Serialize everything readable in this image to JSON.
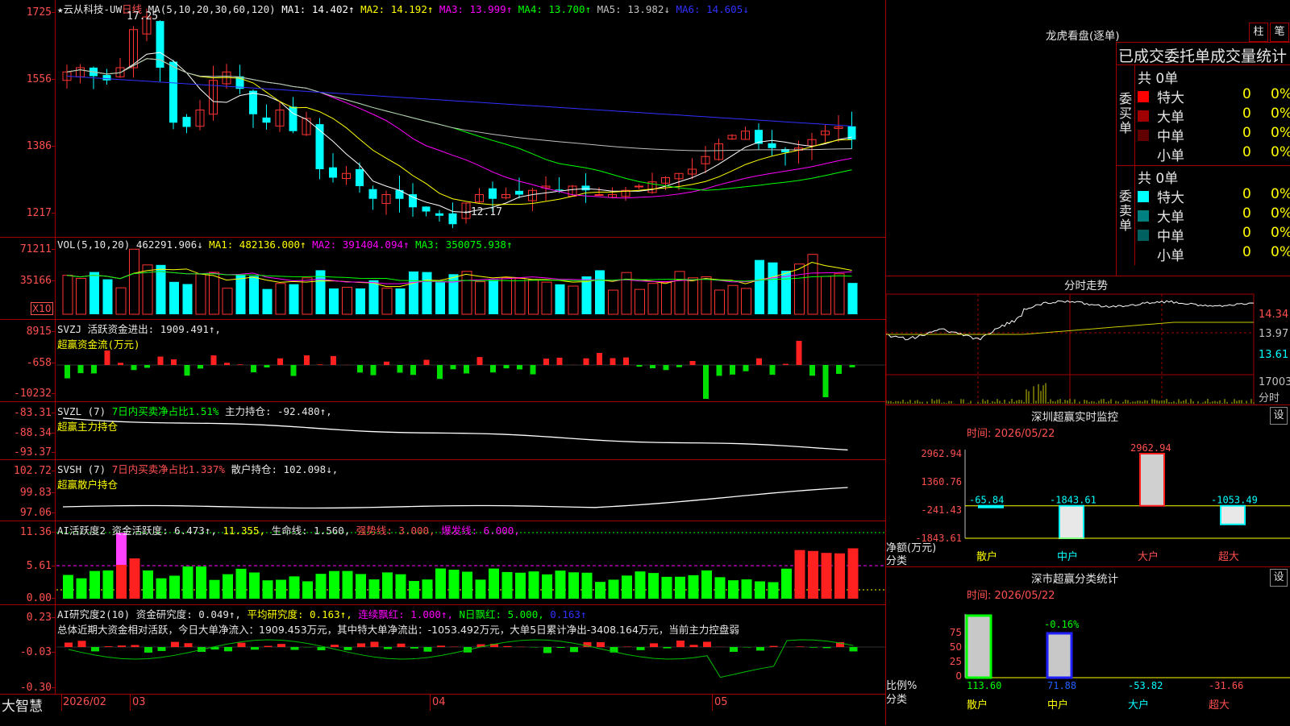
{
  "main": {
    "title": "★云从科技-UW",
    "period": "日线",
    "ma_label": "MA(5,10,20,30,60,120)",
    "ma_values": [
      {
        "text": "MA1: 14.402↑",
        "color": "#ffffff"
      },
      {
        "text": "MA2: 14.192↑",
        "color": "#ffff00"
      },
      {
        "text": "MA3: 13.999↑",
        "color": "#ff00ff"
      },
      {
        "text": "MA4: 13.700↑",
        "color": "#00ff00"
      },
      {
        "text": "MA5: 13.982↓",
        "color": "#c0c0c0"
      },
      {
        "text": "MA6: 14.605↓",
        "color": "#3030ff"
      }
    ],
    "y_ticks": [
      "1725",
      "1556",
      "1386",
      "1217"
    ],
    "high_label": "17.25",
    "low_label": "←12.17",
    "date_labels": [
      "2026/02",
      "03",
      "04",
      "05"
    ]
  },
  "vol": {
    "title": "VOL(5,10,20)",
    "value": "462291.906↓",
    "ma1": "MA1: 482136.000↑",
    "ma2": "MA2: 391404.094↑",
    "ma3": "MA3: 350075.938↑",
    "y_ticks": [
      "71211",
      "35166"
    ],
    "unit": "X10"
  },
  "svzj": {
    "title": "SVZJ",
    "text": "活跃资金进出: 1909.491↑,",
    "subtitle": "超赢资金流(万元)",
    "y_ticks": [
      "8915",
      "-658",
      "-10232"
    ]
  },
  "svzl": {
    "title": "SVZL (7)",
    "ratio": "7日内买卖净占比1.51%",
    "text": "主力持仓: -92.480↑,",
    "subtitle": "超赢主力持仓",
    "y_ticks": [
      "-83.31",
      "-88.34",
      "-93.37"
    ]
  },
  "svsh": {
    "title": "SVSH (7)",
    "ratio": "7日内买卖净占比1.337%",
    "text": "散户持仓: 102.098↓,",
    "subtitle": "超赢散户持仓",
    "y_ticks": [
      "102.72",
      "99.83",
      "97.06"
    ]
  },
  "ai1": {
    "title": "AI活跃度2",
    "text1": "资金活跃度: 6.473↑,",
    "text2": "11.355,",
    "text3": "生命线: 1.560,",
    "text4": "强势线: 3.000,",
    "text5": "爆发线: 6.000,",
    "y_ticks": [
      "11.36",
      "5.61",
      "0.00"
    ]
  },
  "ai2": {
    "title": "AI研究度2(10)",
    "text1": "资金研究度: 0.049↑,",
    "text2": "平均研究度: 0.163↑,",
    "text3": "连续飘红: 1.000↑,",
    "text4": "N日飘红: 5.000,",
    "text5": "0.163↑",
    "summary": "总体近期大资金相对活跃，今日大单净流入：1909.453万元，其中特大单净流出：-1053.492万元，大单5日累计净出-3408.164万元，当前主力控盘弱",
    "y_ticks": [
      "0.23",
      "-0.03",
      "-0.30"
    ]
  },
  "footer": {
    "brand": "大智慧"
  },
  "right": {
    "lhb_title": "龙虎看盘(逐单)",
    "btn_bar": "柱",
    "btn_tick": "笔",
    "stats_title": "已成交委托单成交量统计",
    "buy": {
      "side_label": "委买单",
      "total": "共 0单",
      "rows": [
        {
          "label": "特大",
          "count": "0",
          "pct": "0%",
          "color": "#ff0000"
        },
        {
          "label": "大单",
          "count": "0",
          "pct": "0%",
          "color": "#a00000"
        },
        {
          "label": "中单",
          "count": "0",
          "pct": "0%",
          "color": "#600000"
        },
        {
          "label": "小单",
          "count": "0",
          "pct": "0%",
          "color": "#000000"
        }
      ]
    },
    "sell": {
      "side_label": "委卖单",
      "total": "共 0单",
      "rows": [
        {
          "label": "特大",
          "count": "0",
          "pct": "0%",
          "color": "#00ffff"
        },
        {
          "label": "大单",
          "count": "0",
          "pct": "0%",
          "color": "#008080"
        },
        {
          "label": "中单",
          "count": "0",
          "pct": "0%",
          "color": "#006060"
        },
        {
          "label": "小单",
          "count": "0",
          "pct": "0%",
          "color": "#000000"
        }
      ]
    },
    "intraday": {
      "title": "分时走势",
      "y_ticks": [
        "14.34",
        "13.97",
        "13.61"
      ],
      "vol_tick": "17003",
      "vol_label": "分时"
    },
    "sz_monitor": {
      "title": "深圳超赢实时监控",
      "time": "时间: 2026/05/22",
      "set": "设",
      "y_ticks": [
        "2962.94",
        "1360.76",
        "-241.43",
        "-1843.61"
      ],
      "value_labels": [
        "-65.84",
        "-1843.61",
        "2962.94",
        "-1053.49"
      ],
      "categories": [
        "散户",
        "中户",
        "大户",
        "超大"
      ],
      "values": [
        -65.84,
        -1843.61,
        2962.94,
        -1053.49
      ],
      "ylabel": "净额(万元)",
      "xlabel": "分类"
    },
    "sz_stats": {
      "title": "深市超赢分类统计",
      "time": "时间: 2026/05/22",
      "set": "设",
      "y_ticks": [
        "75",
        "50",
        "25",
        "0"
      ],
      "pct_label": "-0.16%",
      "values": [
        "113.60",
        "71.88",
        "-53.82",
        "-31.66"
      ],
      "categories": [
        "散户",
        "中户",
        "大户",
        "超大"
      ],
      "ylabel": "比例%",
      "xlabel": "分类"
    }
  }
}
